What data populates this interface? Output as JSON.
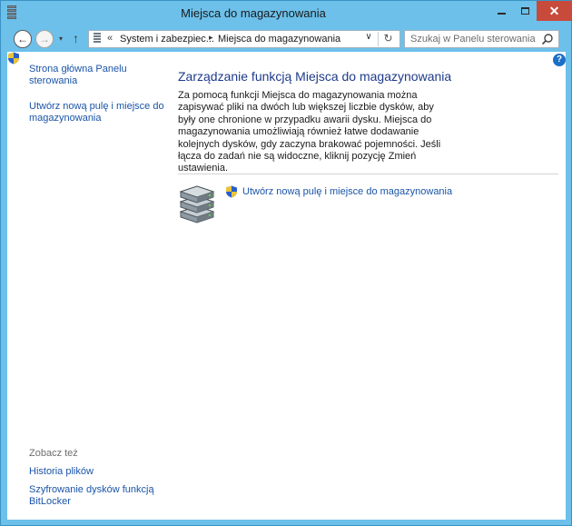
{
  "window": {
    "title": "Miejsca do magazynowania",
    "close_glyph": "✕"
  },
  "nav": {
    "back_glyph": "←",
    "forward_glyph": "→",
    "recent_glyph": "▾",
    "up_glyph": "↑",
    "breadcrumb_chevron": "«",
    "breadcrumb": [
      "System i zabezpiec...",
      "Miejsca do magazynowania"
    ],
    "breadcrumb_separator": "▸",
    "dropdown_glyph": "∨",
    "refresh_glyph": "↻",
    "search_placeholder": "Szukaj w Panelu sterowania"
  },
  "sidebar": {
    "home_link": "Strona główna Panelu sterowania",
    "create_link": "Utwórz nową pulę i miejsce do magazynowania",
    "see_also_label": "Zobacz też",
    "see_also": [
      "Historia plików",
      "Szyfrowanie dysków funkcją BitLocker"
    ]
  },
  "main": {
    "title": "Zarządzanie funkcją Miejsca do magazynowania",
    "description": "Za pomocą funkcji Miejsca do magazynowania można zapisywać pliki na dwóch lub większej liczbie dysków, aby były one chronione w przypadku awarii dysku. Miejsca do magazynowania umożliwiają również łatwe dodawanie kolejnych dysków, gdy zaczyna brakować pojemności. Jeśli łącza do zadań nie są widoczne, kliknij pozycję Zmień ustawienia.",
    "action_link": "Utwórz nową pulę i miejsce do magazynowania",
    "help_glyph": "?"
  },
  "icons": {
    "window": "control-panel-icon",
    "search": "search-icon",
    "shield": "uac-shield-icon",
    "drives": "storage-drives-icon",
    "help": "help-icon"
  },
  "colors": {
    "frame": "#6cc0ea",
    "close_button": "#c74a3b",
    "link": "#1a54a8",
    "heading": "#1e3a8a"
  }
}
